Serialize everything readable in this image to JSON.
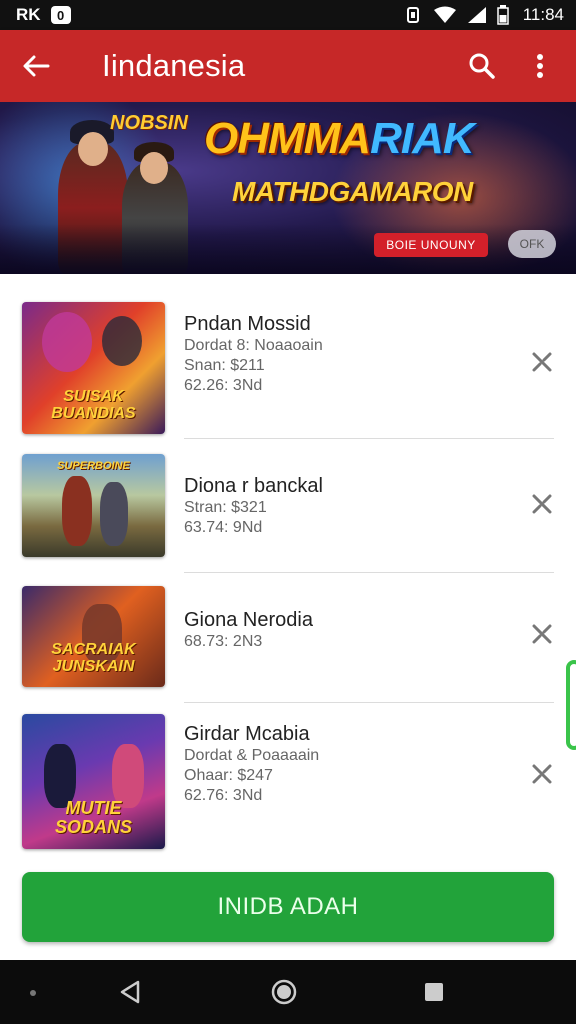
{
  "status_bar": {
    "left_text": "RK",
    "app_badge": "0",
    "time": "11:84",
    "icons": [
      "vibrate-icon",
      "wifi-icon",
      "signal-icon",
      "battery-icon"
    ]
  },
  "app_bar": {
    "title": "Iindanesia",
    "icons": [
      "back-arrow-icon",
      "search-icon",
      "more-vert-icon"
    ],
    "color": "#c62828"
  },
  "banner": {
    "small_logo": "NOBSIN",
    "title_part1": "OHMMA",
    "title_part2": "RIAK",
    "subtitle": "MATHDGAMARON",
    "red_button": "BOIE UNOUNY",
    "grey_button": "OFK"
  },
  "items": [
    {
      "title": "Pndan Mossid",
      "lines": [
        "Dordat 8: Noaaoain",
        "Snan: $211",
        "62.26: 3Nd"
      ],
      "thumb_text": "SUISAK BUANDIAS",
      "action_icon": "unpin-icon"
    },
    {
      "title": "Diona r banckal",
      "lines": [
        "Stran: $321",
        "63.74: 9Nd"
      ],
      "thumb_text": "SUPERBOINE",
      "action_icon": "unpin-icon"
    },
    {
      "title": "Giona Nerodia",
      "lines": [
        "68.73: 2N3"
      ],
      "thumb_text": "SACRAIAK JUNSKAIN",
      "action_icon": "unpin-icon"
    },
    {
      "title": "Girdar Mcabia",
      "lines": [
        "Dordat & Poaaaain",
        "Ohaar: $247",
        "62.76: 3Nd"
      ],
      "thumb_text": "MUTIE SODANS",
      "action_icon": "unpin-icon"
    }
  ],
  "install_button": {
    "label": "INIDB ADAH",
    "color": "#22a33a"
  },
  "nav_bar": {
    "icons": [
      "back-triangle-icon",
      "home-circle-icon",
      "recents-square-icon"
    ]
  }
}
